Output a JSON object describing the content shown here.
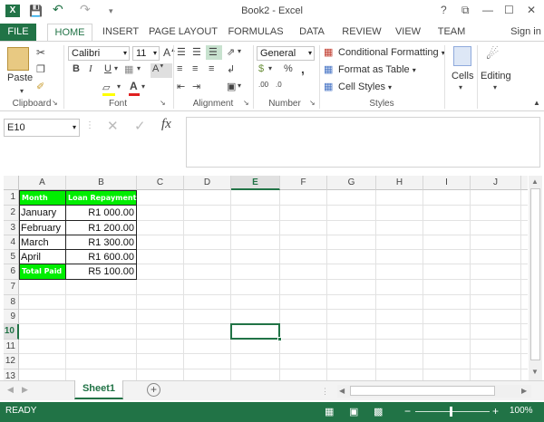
{
  "title": "Book2 - Excel",
  "window": {
    "help": "?",
    "restore": "⧉",
    "minimize": "—",
    "maximize": "☐",
    "close": "✕"
  },
  "qat": {
    "save": "💾",
    "undo": "↶",
    "redo": "↷"
  },
  "tabs": [
    "FILE",
    "HOME",
    "INSERT",
    "PAGE LAYOUT",
    "FORMULAS",
    "DATA",
    "REVIEW",
    "VIEW",
    "TEAM"
  ],
  "signin": "Sign in",
  "clipboard": {
    "paste": "Paste",
    "label": "Clipboard"
  },
  "font": {
    "name": "Calibri",
    "size": "11",
    "bold": "B",
    "italic": "I",
    "underline": "U",
    "label": "Font"
  },
  "alignment": {
    "label": "Alignment"
  },
  "number": {
    "format": "General",
    "currency": "$",
    "percent": "%",
    "comma": ",",
    "inc": ".00",
    "dec": ".0",
    "label": "Number"
  },
  "styles": {
    "conditional": "Conditional Formatting",
    "format_table": "Format as Table",
    "cell_styles": "Cell Styles",
    "label": "Styles"
  },
  "cells": {
    "label": "Cells"
  },
  "editing": {
    "label": "Editing"
  },
  "namebox": "E10",
  "formula": {
    "fx": "fx",
    "value": ""
  },
  "columns": [
    "A",
    "B",
    "C",
    "D",
    "E",
    "F",
    "G",
    "H",
    "I",
    "J"
  ],
  "rows": [
    "1",
    "2",
    "3",
    "4",
    "5",
    "6",
    "7",
    "8",
    "9",
    "10",
    "11",
    "12",
    "13"
  ],
  "cells_data": {
    "a1": "Month",
    "b1": "Loan Repayment",
    "a2": "January",
    "b2": "R1 000.00",
    "a3": "February",
    "b3": "R1 200.00",
    "a4": "March",
    "b4": "R1 300.00",
    "a5": "April",
    "b5": "R1 600.00",
    "a6": "Total Paid",
    "b6": "R5 100.00"
  },
  "sheet_tab": "Sheet1",
  "add_sheet": "+",
  "status": {
    "ready": "READY",
    "zoom": "100%",
    "minus": "−",
    "plus": "+"
  },
  "accent": "#217346",
  "highlight": "#00ee00"
}
